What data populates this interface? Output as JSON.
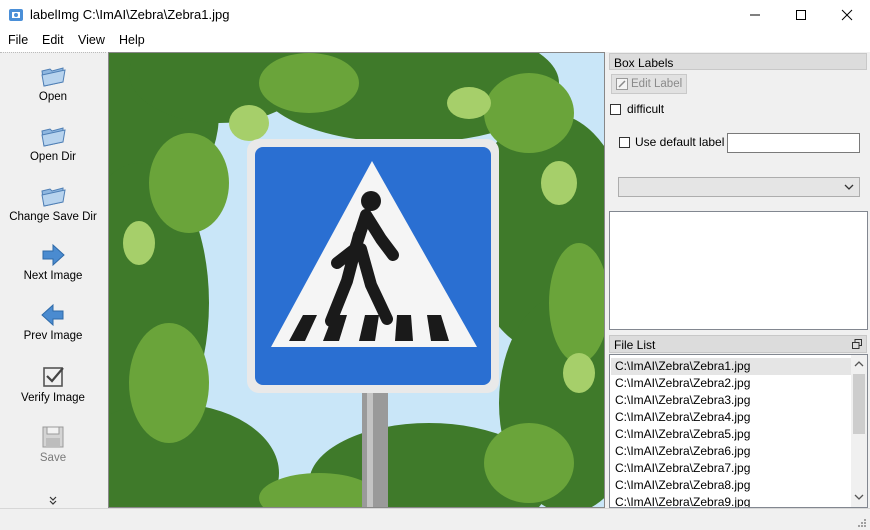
{
  "window": {
    "title": "labelImg C:\\ImAI\\Zebra\\Zebra1.jpg"
  },
  "menu": [
    "File",
    "Edit",
    "View",
    "Help"
  ],
  "toolbar": {
    "open": "Open",
    "open_dir": "Open Dir",
    "change_save_dir": "Change Save Dir",
    "next_image": "Next Image",
    "prev_image": "Prev Image",
    "verify_image": "Verify Image",
    "save": "Save"
  },
  "box_labels": {
    "title": "Box Labels",
    "edit_label": "Edit Label",
    "difficult": "difficult",
    "use_default_label": "Use default label",
    "default_label_value": "",
    "combo_value": ""
  },
  "file_list": {
    "title": "File List",
    "selected_index": 0,
    "items": [
      "C:\\ImAI\\Zebra\\Zebra1.jpg",
      "C:\\ImAI\\Zebra\\Zebra2.jpg",
      "C:\\ImAI\\Zebra\\Zebra3.jpg",
      "C:\\ImAI\\Zebra\\Zebra4.jpg",
      "C:\\ImAI\\Zebra\\Zebra5.jpg",
      "C:\\ImAI\\Zebra\\Zebra6.jpg",
      "C:\\ImAI\\Zebra\\Zebra7.jpg",
      "C:\\ImAI\\Zebra\\Zebra8.jpg",
      "C:\\ImAI\\Zebra\\Zebra9.jpg"
    ]
  },
  "colors": {
    "sign_blue": "#2a6fd2",
    "selection": "#e5e5e5"
  }
}
